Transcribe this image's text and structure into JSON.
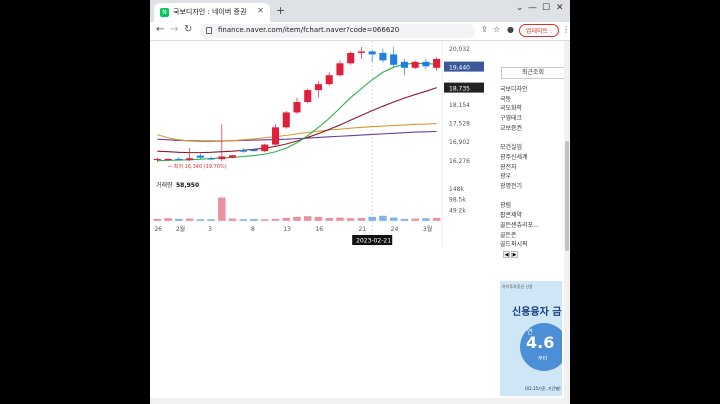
{
  "browser": {
    "tab_title": "국보디자인 : 네이버 증권",
    "favicon_letter": "N",
    "url": "finance.naver.com/item/fchart.naver?code=066620",
    "update_label": "업데이트 :",
    "icons": [
      "back-icon",
      "forward-icon",
      "reload-icon",
      "lock-icon",
      "share-icon",
      "star-icon",
      "extensions-icon",
      "sidepanel-icon",
      "profile-icon",
      "menu-icon"
    ]
  },
  "chart_data": {
    "type": "candlestick",
    "price_axis": [
      "20,032",
      "19,440",
      "18,735",
      "18,154",
      "17,528",
      "16,902",
      "16,276"
    ],
    "current_price": "19,440",
    "ref_price": "18,735",
    "low_label": "← 최저 16,340 (19.70%)",
    "volume_label": "거래량",
    "volume_value": "58,950",
    "volume_axis": [
      "148k",
      "98.5k",
      "49.2k"
    ],
    "x_ticks": [
      "26",
      "2월",
      "3",
      "8",
      "13",
      "16",
      "21",
      "24",
      "3월"
    ],
    "cursor_date": "2023-02-21",
    "ylim": [
      16000,
      20300
    ],
    "candles": [
      {
        "o": 16300,
        "h": 16380,
        "l": 16240,
        "c": 16340
      },
      {
        "o": 16300,
        "h": 16360,
        "l": 16270,
        "c": 16340
      },
      {
        "o": 16340,
        "h": 16400,
        "l": 16280,
        "c": 16300
      },
      {
        "o": 16300,
        "h": 16700,
        "l": 16260,
        "c": 16360
      },
      {
        "o": 16450,
        "h": 16520,
        "l": 16340,
        "c": 16380
      },
      {
        "o": 16360,
        "h": 16420,
        "l": 16300,
        "c": 16330
      },
      {
        "o": 16330,
        "h": 17500,
        "l": 16250,
        "c": 16420
      },
      {
        "o": 16380,
        "h": 16480,
        "l": 16360,
        "c": 16460
      },
      {
        "o": 16640,
        "h": 16700,
        "l": 16540,
        "c": 16580
      },
      {
        "o": 16660,
        "h": 16700,
        "l": 16590,
        "c": 16600
      },
      {
        "o": 16600,
        "h": 16850,
        "l": 16560,
        "c": 16820
      },
      {
        "o": 16820,
        "h": 17500,
        "l": 16780,
        "c": 17400
      },
      {
        "o": 17400,
        "h": 17950,
        "l": 17350,
        "c": 17900
      },
      {
        "o": 17900,
        "h": 18400,
        "l": 17850,
        "c": 18250
      },
      {
        "o": 18250,
        "h": 18700,
        "l": 18200,
        "c": 18650
      },
      {
        "o": 18650,
        "h": 18950,
        "l": 18400,
        "c": 18850
      },
      {
        "o": 18850,
        "h": 19250,
        "l": 18800,
        "c": 19150
      },
      {
        "o": 19150,
        "h": 19650,
        "l": 19100,
        "c": 19550
      },
      {
        "o": 19550,
        "h": 19950,
        "l": 19500,
        "c": 19900
      },
      {
        "o": 19900,
        "h": 20100,
        "l": 19700,
        "c": 19950
      },
      {
        "o": 19950,
        "h": 20000,
        "l": 19600,
        "c": 19850
      },
      {
        "o": 19900,
        "h": 20050,
        "l": 19580,
        "c": 19650
      },
      {
        "o": 19850,
        "h": 20100,
        "l": 19400,
        "c": 19500
      },
      {
        "o": 19600,
        "h": 19700,
        "l": 19150,
        "c": 19400
      },
      {
        "o": 19400,
        "h": 19650,
        "l": 19350,
        "c": 19600
      },
      {
        "o": 19600,
        "h": 19700,
        "l": 19350,
        "c": 19450
      },
      {
        "o": 19400,
        "h": 19750,
        "l": 19300,
        "c": 19700
      }
    ],
    "volumes": [
      6,
      8,
      6,
      7,
      5,
      5,
      68,
      7,
      5,
      6,
      5,
      6,
      9,
      12,
      14,
      12,
      9,
      10,
      8,
      9,
      12,
      15,
      10,
      6,
      7,
      8,
      9
    ],
    "vol_ymax": 148,
    "ma_green": [
      16280,
      16290,
      16300,
      16310,
      16330,
      16350,
      16370,
      16390,
      16420,
      16450,
      16500,
      16580,
      16700,
      16880,
      17120,
      17400,
      17700,
      18050,
      18400,
      18700,
      19000,
      19250,
      19420,
      19520,
      19550,
      19540,
      19520
    ],
    "ma_red": [
      16600,
      16580,
      16560,
      16550,
      16550,
      16560,
      16580,
      16600,
      16630,
      16660,
      16700,
      16760,
      16840,
      16940,
      17060,
      17190,
      17330,
      17480,
      17640,
      17800,
      17960,
      18110,
      18250,
      18380,
      18500,
      18610,
      18735
    ],
    "ma_orange": [
      17150,
      17050,
      16980,
      16940,
      16920,
      16920,
      16930,
      16950,
      16980,
      17010,
      17050,
      17090,
      17130,
      17180,
      17230,
      17270,
      17310,
      17340,
      17370,
      17400,
      17420,
      17440,
      17460,
      17480,
      17500,
      17510,
      17528
    ],
    "ma_purple": [
      17000,
      16980,
      16960,
      16950,
      16940,
      16940,
      16940,
      16950,
      16960,
      16970,
      16980,
      16990,
      17000,
      17020,
      17040,
      17060,
      17080,
      17100,
      17120,
      17140,
      17160,
      17180,
      17200,
      17220,
      17240,
      17250,
      17260
    ],
    "up_color": "#e0203a",
    "down_color": "#1e7fe0"
  },
  "sidebar": {
    "header": "최근조회",
    "items": [
      "국보디자인",
      "국동",
      "국도화학",
      "구영테크",
      "교보증권",
      "",
      "모건실업",
      "광주신세계",
      "광전자",
      "광우",
      "광명전기",
      "",
      "광림",
      "팝콘제약",
      "골든센츄리포...",
      "골든존",
      "골드퍼시픽"
    ],
    "prev": "◀",
    "next": "▶"
  },
  "ad": {
    "top_text": "하이투자증권 신용",
    "headline": "신용융자 금",
    "small": "연",
    "number": "4.6",
    "sub": "부터",
    "foot": "(02.15기준, 기간별)"
  }
}
